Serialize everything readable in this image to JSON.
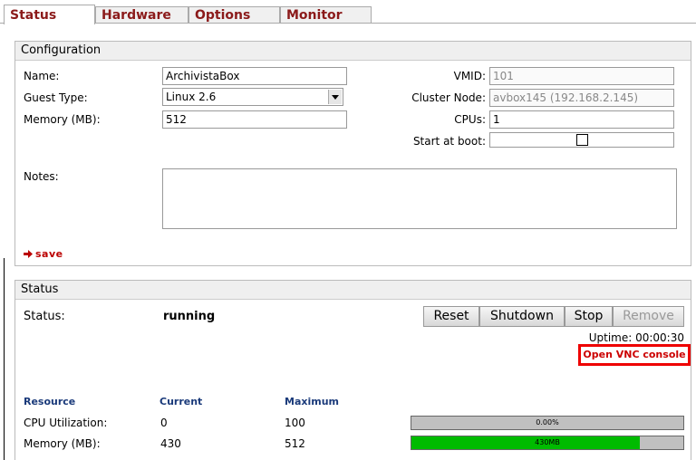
{
  "tabs": [
    {
      "label": "Status",
      "active": true
    },
    {
      "label": "Hardware",
      "active": false
    },
    {
      "label": "Options",
      "active": false
    },
    {
      "label": "Monitor",
      "active": false
    }
  ],
  "config": {
    "title": "Configuration",
    "name_label": "Name:",
    "name_value": "ArchivistaBox",
    "guest_type_label": "Guest Type:",
    "guest_type_value": "Linux 2.6",
    "memory_label": "Memory (MB):",
    "memory_value": "512",
    "vmid_label": "VMID:",
    "vmid_value": "101",
    "cluster_label": "Cluster Node:",
    "cluster_value": "avbox145 (192.168.2.145)",
    "cpus_label": "CPUs:",
    "cpus_value": "1",
    "boot_label": "Start at boot:",
    "boot_checked": false,
    "notes_label": "Notes:",
    "notes_value": "",
    "save_label": "save"
  },
  "status": {
    "title": "Status",
    "status_label": "Status:",
    "status_value": "running",
    "buttons": {
      "reset": "Reset",
      "shutdown": "Shutdown",
      "stop": "Stop",
      "remove": "Remove"
    },
    "uptime": "Uptime: 00:00:30",
    "vnc_label": "Open VNC console"
  },
  "resources": {
    "headers": {
      "resource": "Resource",
      "current": "Current",
      "maximum": "Maximum"
    },
    "rows": [
      {
        "name": "CPU Utilization:",
        "current": "0",
        "maximum": "100",
        "bar_text": "0.00%",
        "fraction": 0.0
      },
      {
        "name": "Memory (MB):",
        "current": "430",
        "maximum": "512",
        "bar_text": "430MB",
        "fraction": 0.84
      }
    ]
  },
  "colors": {
    "bar_fill": "#00bb00",
    "bar_bg": "#c0c0c0",
    "tab_text": "#8b1a1a",
    "vnc_border": "#ee0000"
  }
}
